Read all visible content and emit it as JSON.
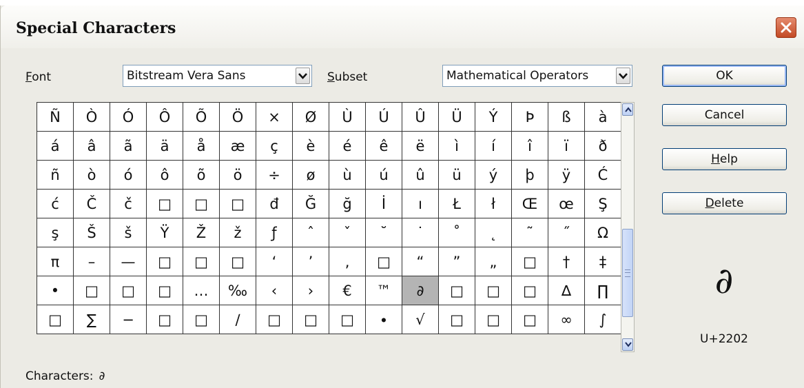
{
  "title": "Special Characters",
  "font": {
    "label": "Font",
    "value": "Bitstream Vera Sans"
  },
  "subset": {
    "label": "Subset",
    "value": "Mathematical Operators"
  },
  "grid": {
    "rows": [
      [
        "Ñ",
        "Ò",
        "Ó",
        "Ô",
        "Õ",
        "Ö",
        "×",
        "Ø",
        "Ù",
        "Ú",
        "Û",
        "Ü",
        "Ý",
        "Þ",
        "ß",
        "à"
      ],
      [
        "á",
        "â",
        "ã",
        "ä",
        "å",
        "æ",
        "ç",
        "è",
        "é",
        "ê",
        "ë",
        "ì",
        "í",
        "î",
        "ï",
        "ð"
      ],
      [
        "ñ",
        "ò",
        "ó",
        "ô",
        "õ",
        "ö",
        "÷",
        "ø",
        "ù",
        "ú",
        "û",
        "ü",
        "ý",
        "þ",
        "ÿ",
        "Ć"
      ],
      [
        "ć",
        "Č",
        "č",
        "□",
        "□",
        "□",
        "đ",
        "Ğ",
        "ğ",
        "İ",
        "ı",
        "Ł",
        "ł",
        "Œ",
        "œ",
        "Ş"
      ],
      [
        "ş",
        "Š",
        "š",
        "Ÿ",
        "Ž",
        "ž",
        "ƒ",
        "ˆ",
        "ˇ",
        "˘",
        "˙",
        "˚",
        "˛",
        "˜",
        "˝",
        "Ω"
      ],
      [
        "π",
        "–",
        "—",
        "□",
        "□",
        "□",
        "‘",
        "’",
        "‚",
        "□",
        "“",
        "”",
        "„",
        "□",
        "†",
        "‡"
      ],
      [
        "•",
        "□",
        "□",
        "□",
        "…",
        "‰",
        "‹",
        "›",
        "€",
        "™",
        "∂",
        "□",
        "□",
        "□",
        "∆",
        "∏"
      ],
      [
        "□",
        "∑",
        "−",
        "□",
        "□",
        "∕",
        "□",
        "□",
        "□",
        "∙",
        "√",
        "□",
        "□",
        "□",
        "∞",
        "∫"
      ]
    ],
    "selected": "∂"
  },
  "buttons": {
    "ok": "OK",
    "cancel": "Cancel",
    "help": "Help",
    "delete": "Delete"
  },
  "preview": {
    "character": "∂",
    "code": "U+2202"
  },
  "characters": {
    "label": "Characters:",
    "value": "∂"
  }
}
